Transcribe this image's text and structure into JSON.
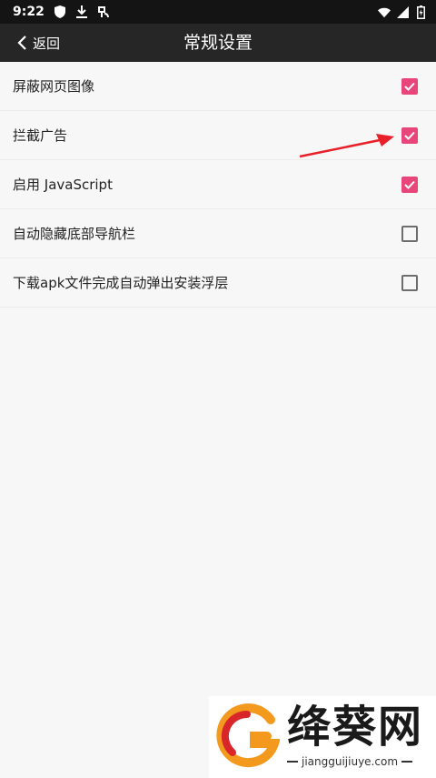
{
  "status_bar": {
    "time": "9:22",
    "left_icons": [
      "shield-icon",
      "download-icon",
      "app-icon"
    ],
    "right_icons": [
      "wifi-icon",
      "signal-icon",
      "battery-icon"
    ]
  },
  "nav": {
    "back_label": "返回",
    "title": "常规设置"
  },
  "settings": {
    "items": [
      {
        "label": "屏蔽网页图像",
        "checked": true
      },
      {
        "label": "拦截广告",
        "checked": true
      },
      {
        "label": "启用 JavaScript",
        "checked": true
      },
      {
        "label": "自动隐藏底部导航栏",
        "checked": false
      },
      {
        "label": "下载apk文件完成自动弹出安装浮层",
        "checked": false
      }
    ]
  },
  "watermark": {
    "name": "绛葵网",
    "url": "jiangguijiuye.com"
  },
  "colors": {
    "accent": "#e8457a",
    "annotation_arrow": "#e8202a",
    "status_bar_bg": "#141414",
    "nav_bg": "#262626"
  }
}
